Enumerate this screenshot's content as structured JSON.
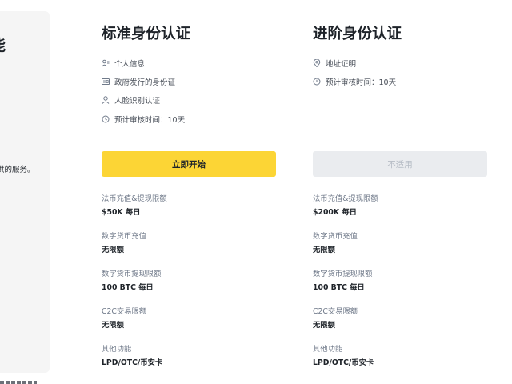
{
  "left": {
    "title_fragment": "能",
    "desc_fragment": "供的服务。"
  },
  "standard": {
    "title": "标准身份认证",
    "requirements": [
      {
        "icon": "person-info-icon",
        "label": "个人信息"
      },
      {
        "icon": "id-card-icon",
        "label": "政府发行的身份证"
      },
      {
        "icon": "face-person-icon",
        "label": "人脸识别认证"
      },
      {
        "icon": "clock-icon",
        "label": "预计审核时间：10天"
      }
    ],
    "button_label": "立即开始",
    "limits": [
      {
        "label": "法币充值&提现限额",
        "value": "$50K 每日"
      },
      {
        "label": "数字货币充值",
        "value": "无限额"
      },
      {
        "label": "数字货币提现限额",
        "value": "100 BTC 每日"
      },
      {
        "label": "C2C交易限额",
        "value": "无限额"
      },
      {
        "label": "其他功能",
        "value": "LPD/OTC/币安卡"
      }
    ]
  },
  "advanced": {
    "title": "进阶身份认证",
    "requirements": [
      {
        "icon": "location-pin-icon",
        "label": "地址证明"
      },
      {
        "icon": "clock-icon",
        "label": "预计审核时间：10天"
      }
    ],
    "button_label": "不适用",
    "limits": [
      {
        "label": "法币充值&提现限额",
        "value": "$200K 每日"
      },
      {
        "label": "数字货币充值",
        "value": "无限额"
      },
      {
        "label": "数字货币提现限额",
        "value": "100 BTC 每日"
      },
      {
        "label": "C2C交易限额",
        "value": "无限额"
      },
      {
        "label": "其他功能",
        "value": "LPD/OTC/币安卡"
      }
    ]
  },
  "colors": {
    "accent": "#fcd535",
    "text_primary": "#1e2329",
    "text_secondary": "#707a8a",
    "disabled_bg": "#eaecef",
    "disabled_text": "#b7bdc6",
    "panel_bg": "#f5f5f5"
  }
}
